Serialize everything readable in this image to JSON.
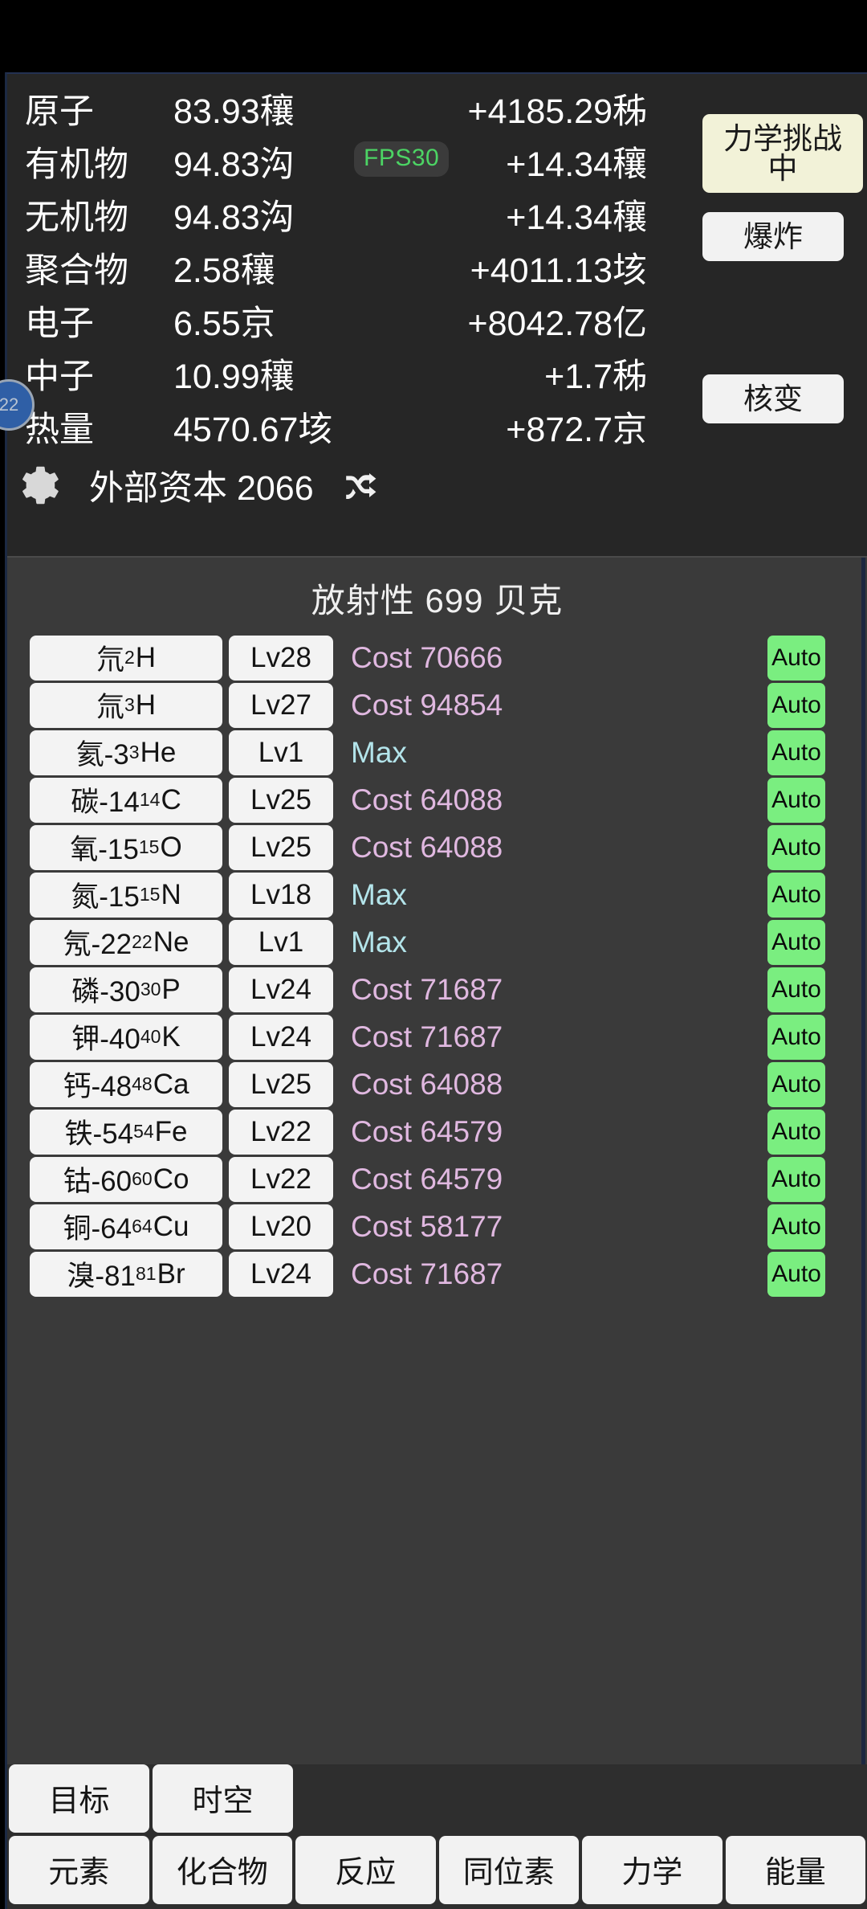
{
  "stats": {
    "rows": [
      {
        "name": "原子",
        "value": "83.93穰",
        "delta": "+4185.29秭"
      },
      {
        "name": "有机物",
        "value": "94.83沟",
        "delta": "+14.34穰"
      },
      {
        "name": "无机物",
        "value": "94.83沟",
        "delta": "+14.34穰"
      },
      {
        "name": "聚合物",
        "value": "2.58穰",
        "delta": "+4011.13垓"
      },
      {
        "name": "电子",
        "value": "6.55京",
        "delta": "+8042.78亿"
      },
      {
        "name": "中子",
        "value": "10.99穰",
        "delta": "+1.7秭"
      },
      {
        "name": "热量",
        "value": "4570.67垓",
        "delta": "+872.7京"
      }
    ]
  },
  "fps": {
    "label": "FPS30",
    "color": "#4cd464"
  },
  "resource_bar": {
    "gear_icon": "gear-icon",
    "capital_label": "外部资本 2066",
    "shuffle_icon": "shuffle-icon"
  },
  "float_widget": {
    "label": "22"
  },
  "side_buttons": {
    "challenge": "力学挑战中",
    "explode": "爆炸",
    "nuclear": "核变"
  },
  "isotopes": {
    "title": "放射性 699 贝克",
    "auto_label": "Auto",
    "max_label": "Max",
    "cost_prefix": "Cost",
    "colors": {
      "cost": "#e0b8e0",
      "max": "#b3e4ea",
      "auto_bg": "#7aee80"
    },
    "rows": [
      {
        "name": "氘",
        "sup": "2",
        "sym": "H",
        "level": "Lv28",
        "status": "Cost 70666",
        "is_max": false,
        "auto": "Auto"
      },
      {
        "name": "氚",
        "sup": "3",
        "sym": "H",
        "level": "Lv27",
        "status": "Cost 94854",
        "is_max": false,
        "auto": "Auto"
      },
      {
        "name": "氦-3",
        "sup": "3",
        "sym": "He",
        "level": "Lv1",
        "status": "Max",
        "is_max": true,
        "auto": "Auto"
      },
      {
        "name": "碳-14",
        "sup": "14",
        "sym": "C",
        "level": "Lv25",
        "status": "Cost 64088",
        "is_max": false,
        "auto": "Auto"
      },
      {
        "name": "氧-15",
        "sup": "15",
        "sym": "O",
        "level": "Lv25",
        "status": "Cost 64088",
        "is_max": false,
        "auto": "Auto"
      },
      {
        "name": "氮-15",
        "sup": "15",
        "sym": "N",
        "level": "Lv18",
        "status": "Max",
        "is_max": true,
        "auto": "Auto"
      },
      {
        "name": "氖-22",
        "sup": "22",
        "sym": "Ne",
        "level": "Lv1",
        "status": "Max",
        "is_max": true,
        "auto": "Auto"
      },
      {
        "name": "磷-30",
        "sup": "30",
        "sym": "P",
        "level": "Lv24",
        "status": "Cost 71687",
        "is_max": false,
        "auto": "Auto"
      },
      {
        "name": "钾-40",
        "sup": "40",
        "sym": "K",
        "level": "Lv24",
        "status": "Cost 71687",
        "is_max": false,
        "auto": "Auto"
      },
      {
        "name": "钙-48",
        "sup": "48",
        "sym": "Ca",
        "level": "Lv25",
        "status": "Cost 64088",
        "is_max": false,
        "auto": "Auto"
      },
      {
        "name": "铁-54",
        "sup": "54",
        "sym": "Fe",
        "level": "Lv22",
        "status": "Cost 64579",
        "is_max": false,
        "auto": "Auto"
      },
      {
        "name": "钴-60",
        "sup": "60",
        "sym": "Co",
        "level": "Lv22",
        "status": "Cost 64579",
        "is_max": false,
        "auto": "Auto"
      },
      {
        "name": "铜-64",
        "sup": "64",
        "sym": "Cu",
        "level": "Lv20",
        "status": "Cost 58177",
        "is_max": false,
        "auto": "Auto"
      },
      {
        "name": "溴-81",
        "sup": "81",
        "sym": "Br",
        "level": "Lv24",
        "status": "Cost 71687",
        "is_max": false,
        "auto": "Auto"
      }
    ]
  },
  "tabs": {
    "row1": [
      "目标",
      "时空"
    ],
    "row2": [
      "元素",
      "化合物",
      "反应",
      "同位素",
      "力学",
      "能量"
    ]
  }
}
